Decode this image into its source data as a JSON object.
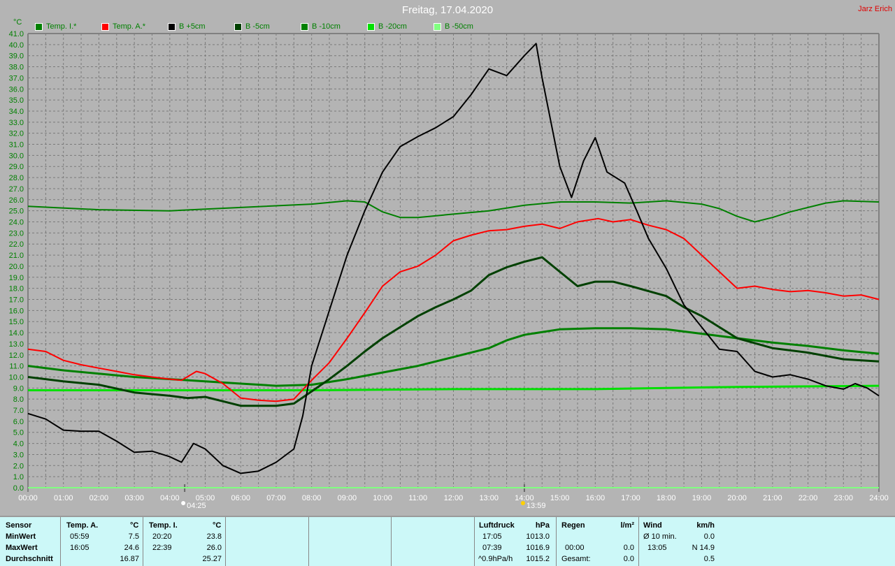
{
  "header": {
    "title": "Freitag, 17.04.2020",
    "author": "Jarz Erich",
    "unit": "°C"
  },
  "legend": [
    {
      "label": "Temp. I.*",
      "color": "#008000"
    },
    {
      "label": "Temp. A.*",
      "color": "#ff0000"
    },
    {
      "label": "B +5cm",
      "color": "#000000"
    },
    {
      "label": "B -5cm",
      "color": "#004000"
    },
    {
      "label": "B -10cm",
      "color": "#008000"
    },
    {
      "label": "B -20cm",
      "color": "#00e000"
    },
    {
      "label": "B -50cm",
      "color": "#80ff80"
    }
  ],
  "markers": [
    {
      "label": "04:25",
      "hour": 4.42
    },
    {
      "label": "13:59",
      "hour": 14.0
    }
  ],
  "chart_data": {
    "type": "line",
    "title": "Freitag, 17.04.2020",
    "ylabel": "°C",
    "ylim": [
      0,
      41
    ],
    "xlim": [
      0,
      24
    ],
    "xticks": [
      "00:00",
      "01:00",
      "02:00",
      "03:00",
      "04:00",
      "05:00",
      "06:00",
      "07:00",
      "08:00",
      "09:00",
      "10:00",
      "11:00",
      "12:00",
      "13:00",
      "14:00",
      "15:00",
      "16:00",
      "17:00",
      "18:00",
      "19:00",
      "20:00",
      "21:00",
      "22:00",
      "23:00",
      "24:00"
    ],
    "grid": true,
    "legend_position": "top",
    "series": [
      {
        "name": "Temp. I.*",
        "color": "#008000",
        "width": 2,
        "x": [
          0,
          2,
          4,
          6,
          8,
          9,
          9.5,
          10,
          10.5,
          11,
          12,
          13,
          14,
          15,
          16,
          17,
          18,
          19,
          19.5,
          20,
          20.5,
          21,
          21.5,
          22,
          22.5,
          23,
          24
        ],
        "y": [
          25.4,
          25.1,
          25.0,
          25.3,
          25.6,
          25.9,
          25.8,
          24.9,
          24.4,
          24.4,
          24.7,
          25.0,
          25.5,
          25.8,
          25.8,
          25.7,
          25.9,
          25.6,
          25.2,
          24.5,
          24.0,
          24.4,
          24.9,
          25.3,
          25.7,
          25.9,
          25.8
        ]
      },
      {
        "name": "Temp. A.*",
        "color": "#ff0000",
        "width": 2,
        "x": [
          0,
          0.5,
          1,
          1.5,
          2,
          2.5,
          3,
          3.5,
          4,
          4.33,
          4.75,
          5,
          5.5,
          6,
          6.5,
          7,
          7.5,
          8,
          8.5,
          9,
          9.5,
          10,
          10.5,
          11,
          11.5,
          12,
          12.5,
          13,
          13.5,
          14,
          14.5,
          15,
          15.5,
          16.08,
          16.5,
          17,
          17.5,
          18,
          18.5,
          19,
          19.5,
          20,
          20.5,
          21,
          21.5,
          22,
          22.5,
          23,
          23.5,
          24
        ],
        "y": [
          12.5,
          12.3,
          11.5,
          11.1,
          10.8,
          10.5,
          10.2,
          10.0,
          9.8,
          9.7,
          10.5,
          10.3,
          9.4,
          8.1,
          7.9,
          7.8,
          8.0,
          9.7,
          11.3,
          13.5,
          15.8,
          18.2,
          19.5,
          20.0,
          21.0,
          22.3,
          22.8,
          23.2,
          23.3,
          23.6,
          23.8,
          23.4,
          24.0,
          24.3,
          24.0,
          24.2,
          23.7,
          23.3,
          22.5,
          21.0,
          19.5,
          18.0,
          18.2,
          17.9,
          17.7,
          17.8,
          17.6,
          17.3,
          17.4,
          17.0
        ]
      },
      {
        "name": "B +5cm",
        "color": "#000000",
        "width": 2,
        "x": [
          0,
          0.5,
          1,
          1.5,
          2,
          2.5,
          3,
          3.5,
          4,
          4.33,
          4.67,
          5,
          5.5,
          6,
          6.5,
          7,
          7.5,
          7.75,
          8,
          8.5,
          9,
          9.5,
          10,
          10.5,
          11,
          11.5,
          12,
          12.5,
          13,
          13.5,
          14,
          14.33,
          14.5,
          15,
          15.33,
          15.67,
          16,
          16.33,
          16.83,
          17.17,
          17.5,
          18,
          18.5,
          19,
          19.5,
          20,
          20.5,
          21,
          21.5,
          22,
          22.5,
          23,
          23.33,
          23.67,
          24
        ],
        "y": [
          6.7,
          6.2,
          5.2,
          5.1,
          5.1,
          4.2,
          3.2,
          3.3,
          2.8,
          2.3,
          4.0,
          3.5,
          2.0,
          1.3,
          1.5,
          2.3,
          3.5,
          6.5,
          11,
          16,
          21,
          25,
          28.5,
          30.8,
          31.7,
          32.5,
          33.5,
          35.5,
          37.8,
          37.2,
          39.0,
          40.1,
          37,
          29,
          26.2,
          29.5,
          31.6,
          28.5,
          27.5,
          25.0,
          22.5,
          19.8,
          16.5,
          14.5,
          12.5,
          12.3,
          10.5,
          10.0,
          10.2,
          9.8,
          9.2,
          8.9,
          9.4,
          9.0,
          8.3
        ]
      },
      {
        "name": "B -5cm",
        "color": "#004000",
        "width": 3,
        "x": [
          0,
          1,
          2,
          3,
          4,
          4.5,
          5,
          5.5,
          6,
          7,
          7.5,
          8,
          8.5,
          9,
          9.5,
          10,
          10.5,
          11,
          11.5,
          12,
          12.5,
          13,
          13.5,
          14,
          14.5,
          15,
          15.5,
          16,
          16.5,
          17,
          18,
          18.5,
          19,
          19.5,
          20,
          21,
          22,
          23,
          24
        ],
        "y": [
          10.0,
          9.6,
          9.3,
          8.6,
          8.3,
          8.1,
          8.2,
          7.8,
          7.4,
          7.4,
          7.6,
          8.7,
          9.8,
          11.0,
          12.3,
          13.5,
          14.5,
          15.5,
          16.3,
          17.0,
          17.8,
          19.2,
          19.9,
          20.4,
          20.8,
          19.5,
          18.2,
          18.6,
          18.6,
          18.2,
          17.3,
          16.3,
          15.5,
          14.5,
          13.5,
          12.6,
          12.2,
          11.6,
          11.4
        ]
      },
      {
        "name": "B -10cm",
        "color": "#008000",
        "width": 3,
        "x": [
          0,
          1,
          2,
          3,
          4,
          5,
          6,
          7,
          8,
          9,
          10,
          11,
          12,
          13,
          13.5,
          14,
          15,
          16,
          17,
          18,
          19,
          20,
          21,
          22,
          23,
          24
        ],
        "y": [
          11.0,
          10.6,
          10.3,
          10.0,
          9.8,
          9.6,
          9.4,
          9.2,
          9.3,
          9.8,
          10.4,
          11.0,
          11.8,
          12.6,
          13.3,
          13.8,
          14.3,
          14.4,
          14.4,
          14.3,
          13.9,
          13.5,
          13.1,
          12.8,
          12.4,
          12.1
        ]
      },
      {
        "name": "B -20cm",
        "color": "#00e000",
        "width": 3,
        "x": [
          0,
          4,
          8,
          12,
          16,
          20,
          24
        ],
        "y": [
          8.8,
          8.8,
          8.8,
          8.9,
          8.9,
          9.1,
          9.2
        ]
      },
      {
        "name": "B -50cm",
        "color": "#80ff80",
        "width": 2,
        "x": [
          0,
          24
        ],
        "y": [
          0,
          0
        ]
      }
    ]
  },
  "stats": {
    "sensor": "Sensor",
    "min": "MinWert",
    "max": "MaxWert",
    "avg": "Durchschnitt",
    "temp_a": {
      "label": "Temp. A.",
      "unit": "°C",
      "min_time": "05:59",
      "min": "7.5",
      "max_time": "16:05",
      "max": "24.6",
      "avg": "16.87"
    },
    "temp_i": {
      "label": "Temp. I.",
      "unit": "°C",
      "min_time": "20:20",
      "min": "23.8",
      "max_time": "22:39",
      "max": "26.0",
      "avg": "25.27"
    },
    "pressure": {
      "label": "Luftdruck",
      "unit": "hPa",
      "r1a": "17:05",
      "r1b": "1013.0",
      "r2a": "07:39",
      "r2b": "1016.9",
      "r3a": "^0.9hPa/h",
      "r3b": "1015.2"
    },
    "rain": {
      "label": "Regen",
      "unit": "l/m²",
      "r2a": "00:00",
      "r2b": "0.0",
      "r3a": "Gesamt:",
      "r3b": "0.0"
    },
    "wind": {
      "label": "Wind",
      "unit": "km/h",
      "r1a": "Ø 10 min.",
      "r1b": "0.0",
      "r2a": "13:05",
      "r2b": "N 14.9",
      "r3b": "0.5"
    }
  }
}
